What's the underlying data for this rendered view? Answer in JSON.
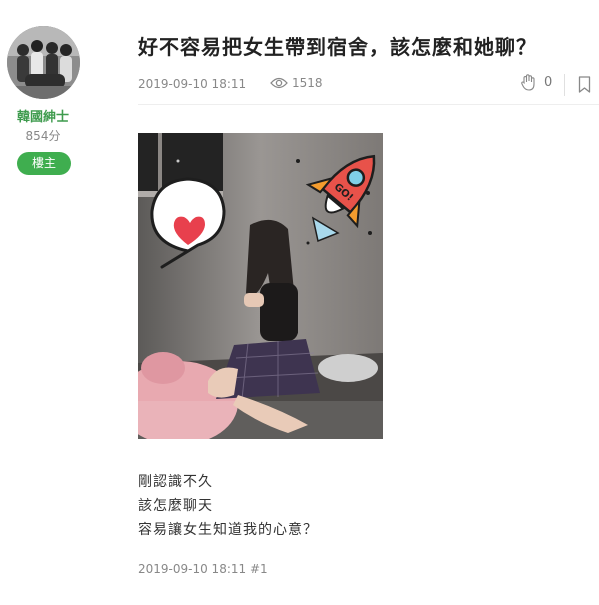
{
  "author": {
    "name": "韓國紳士",
    "score": "854分",
    "badge": "樓主"
  },
  "post": {
    "title": "好不容易把女生帶到宿舍，該怎麼和她聊？",
    "date": "2019-09-10 18:11",
    "views": "1518",
    "likes": "0",
    "image_text": {
      "rocket_label": "GO!"
    },
    "body_lines": [
      "剛認識不久",
      "該怎麼聊天",
      "容易讓女生知道我的心意？"
    ],
    "footer_date": "2019-09-10 18:11",
    "floor": "#1"
  },
  "icons": {
    "views": "eye-icon",
    "like": "clap-hand-icon",
    "bookmark": "bookmark-icon"
  },
  "colors": {
    "accent_green": "#3fae4f",
    "username_green": "#3f9b4e",
    "meta_gray": "#888888"
  }
}
